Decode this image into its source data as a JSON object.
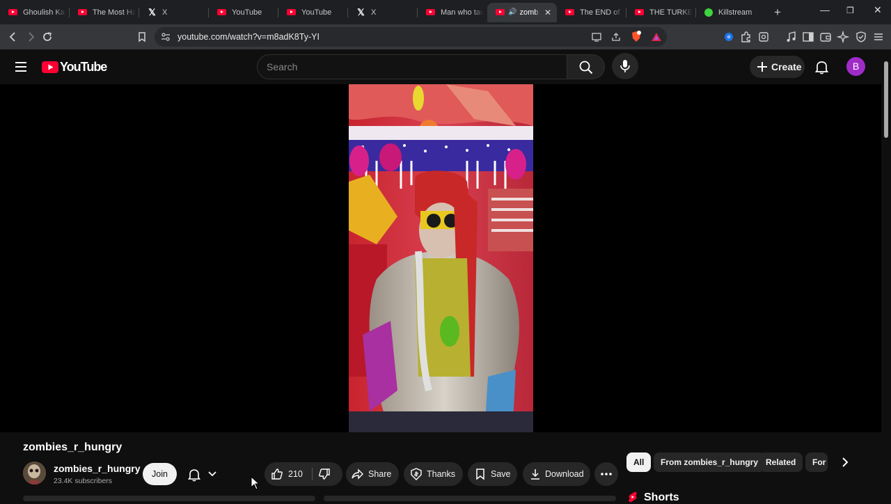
{
  "browser": {
    "tabs": [
      {
        "label": "Ghoulish Kar",
        "icon": "youtube-favicon"
      },
      {
        "label": "The Most Hat",
        "icon": "youtube-favicon"
      },
      {
        "label": "X",
        "icon": "x-favicon"
      },
      {
        "label": "YouTube",
        "icon": "youtube-favicon"
      },
      {
        "label": "YouTube",
        "icon": "youtube-favicon"
      },
      {
        "label": "X",
        "icon": "x-favicon"
      },
      {
        "label": "Man who tau",
        "icon": "youtube-favicon"
      },
      {
        "label": "zomb",
        "icon": "youtube-favicon",
        "active": true
      },
      {
        "label": "The END of L",
        "icon": "youtube-favicon"
      },
      {
        "label": "THE TURKEY",
        "icon": "youtube-favicon"
      },
      {
        "label": "Killstream",
        "icon": "kick-favicon"
      }
    ],
    "url": "youtube.com/watch?v=m8adK8Ty-YI"
  },
  "youtube": {
    "logo": "YouTube",
    "search_placeholder": "Search",
    "create_label": "Create",
    "avatar_letter": "B",
    "accent": "#ff0033"
  },
  "video": {
    "channel_title": "zombies_r_hungry",
    "channel_name": "zombies_r_hungry",
    "subscribers": "23.4K subscribers",
    "join_label": "Join",
    "likes": "210",
    "share_label": "Share",
    "thanks_label": "Thanks",
    "save_label": "Save",
    "download_label": "Download"
  },
  "sidebar": {
    "chips": [
      "All",
      "From zombies_r_hungry",
      "Related",
      "For"
    ],
    "shorts_label": "Shorts"
  }
}
